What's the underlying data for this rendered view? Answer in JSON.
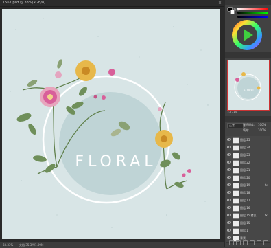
{
  "document": {
    "title": "1567.psd @ 33%(RGB/8)",
    "close_glyph": "×"
  },
  "artboard": {
    "bg_color": "#d8e5e6",
    "ring_color": "#ffffff",
    "inner_circle_color": "#bfd4d6",
    "heading": "FLORAL"
  },
  "status": {
    "zoom": "33.33%",
    "doc_size": "文档:35.3M/1.09M"
  },
  "panel": {
    "color_tabs": "颜色  色板",
    "navigator_tabs": "导航器  直方图",
    "navigator_zoom": "33.33%",
    "layers_tabs": "图层  通道  路径",
    "blend_mode": "正常",
    "opacity_label": "不透明度:",
    "opacity_value": "100%",
    "fill_label": "填充:",
    "fill_value": "100%",
    "layers": [
      {
        "name": "图层 25",
        "fx": ""
      },
      {
        "name": "图层 24",
        "fx": ""
      },
      {
        "name": "图层 23",
        "fx": ""
      },
      {
        "name": "图层 22",
        "fx": ""
      },
      {
        "name": "图层 21",
        "fx": ""
      },
      {
        "name": "图层 20",
        "fx": ""
      },
      {
        "name": "图层 19",
        "fx": "fx"
      },
      {
        "name": "图层 18",
        "fx": ""
      },
      {
        "name": "图层 17",
        "fx": ""
      },
      {
        "name": "图层 16",
        "fx": ""
      },
      {
        "name": "图层 15 拷贝",
        "fx": "fx"
      },
      {
        "name": "图层 15",
        "fx": ""
      },
      {
        "name": "图层 1",
        "fx": ""
      },
      {
        "name": "背景",
        "fx": ""
      }
    ]
  }
}
